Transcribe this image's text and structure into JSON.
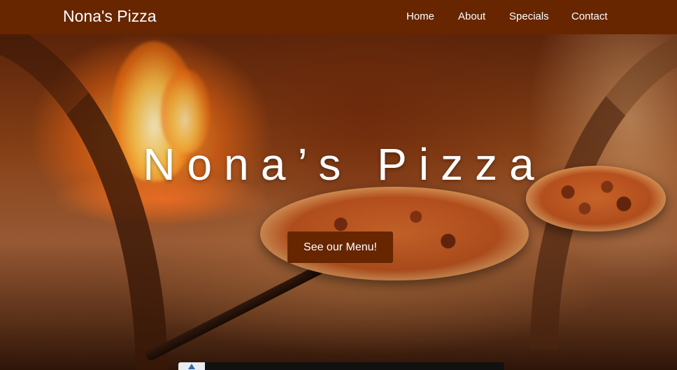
{
  "navbar": {
    "brand": "Nona's Pizza",
    "links": [
      {
        "label": "Home"
      },
      {
        "label": "About"
      },
      {
        "label": "Specials"
      },
      {
        "label": "Contact"
      }
    ]
  },
  "hero": {
    "title": "Nona’s Pizza",
    "cta_label": "See our Menu!"
  },
  "colors": {
    "brand": "#672600",
    "text": "#ffffff"
  }
}
